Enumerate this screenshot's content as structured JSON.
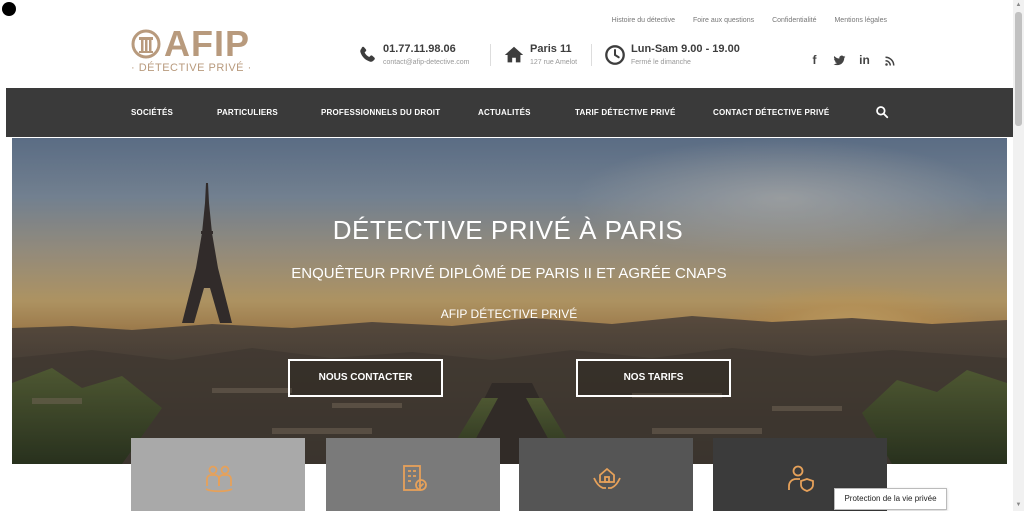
{
  "brand": {
    "name": "AFIP",
    "tagline": "· DÉTECTIVE PRIVÉ ·",
    "accent_color": "#b89a7d"
  },
  "top_links": [
    "Histoire du détective",
    "Foire aux questions",
    "Confidentialité",
    "Mentions légales"
  ],
  "contact": {
    "phone": "01.77.11.98.06",
    "email": "contact@afip-detective.com",
    "city": "Paris 11",
    "street": "127 rue Amelot",
    "hours": "Lun-Sam 9.00 - 19.00",
    "closed": "Fermé le dimanche"
  },
  "social": {
    "facebook": "f",
    "linkedin": "in",
    "icons": [
      "facebook-icon",
      "twitter-icon",
      "linkedin-icon",
      "rss-icon"
    ]
  },
  "nav": {
    "items": [
      "SOCIÉTÉS",
      "PARTICULIERS",
      "PROFESSIONNELS DU DROIT",
      "ACTUALITÉS",
      "TARIF DÉTECTIVE PRIVÉ",
      "CONTACT DÉTECTIVE PRIVÉ"
    ],
    "background": "#3a3a3a"
  },
  "hero": {
    "title": "DÉTECTIVE PRIVÉ À PARIS",
    "subtitle": "ENQUÊTEUR PRIVÉ DIPLÔMÉ DE PARIS II ET AGRÉE CNAPS",
    "brand": "AFIP DÉTECTIVE PRIVÉ",
    "button_contact": "NOUS CONTACTER",
    "button_tarifs": "NOS TARIFS"
  },
  "cards": {
    "icons": [
      "family-icon",
      "building-icon",
      "house-hands-icon",
      "person-shield-icon"
    ],
    "colors": [
      "#a9a9a9",
      "#7a7a7a",
      "#555555",
      "#3b3b3b"
    ]
  },
  "tooltip": "Protection de la vie privée"
}
